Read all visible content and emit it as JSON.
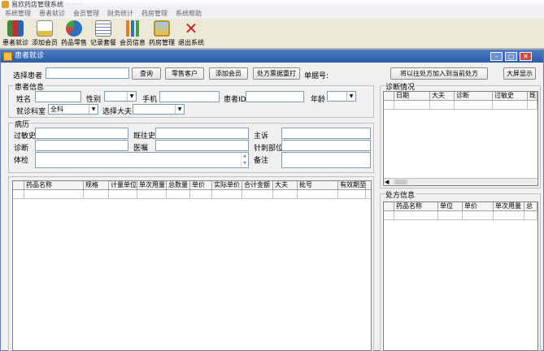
{
  "app": {
    "title": "易欣药店管理系统",
    "title_dim": "········"
  },
  "menu": [
    "系统管理",
    "患者就诊",
    "会员管理",
    "财务统计",
    "药房管理",
    "系统帮助"
  ],
  "toolbar": [
    {
      "label": "患者就诊",
      "icon": "books-icon",
      "color": "#3a8a3a"
    },
    {
      "label": "添加会员",
      "icon": "add-member-icon",
      "color": "#e0c040"
    },
    {
      "label": "药品零售",
      "icon": "pie-chart-icon",
      "color": "#3070c0"
    },
    {
      "label": "记录套餐",
      "icon": "list-icon",
      "color": "#f0f0f0"
    },
    {
      "label": "会员信息",
      "icon": "bar-chart-icon",
      "color": "#e08020"
    },
    {
      "label": "药房管理",
      "icon": "picture-icon",
      "color": "#f0c040"
    },
    {
      "label": "退出系统",
      "icon": "close-icon",
      "color": "#d02020"
    }
  ],
  "window": {
    "title": "患者就诊"
  },
  "top": {
    "select_patient_label": "选择患者",
    "select_patient_value": "",
    "query": "查询",
    "walkin": "零售客户",
    "add_member": "添加会员",
    "reprint": "处方票据重打",
    "order_no_label": "单据号:",
    "add_prev": "将以往处方加入到当前处方",
    "big_screen": "大屏显示"
  },
  "patient": {
    "group": "患者信息",
    "name": "姓名",
    "gender": "性别",
    "phone": "手机",
    "pid": "患者ID",
    "age": "年龄",
    "dept": "就诊科室",
    "dept_value": "全科",
    "doctor": "选择大夫"
  },
  "history": {
    "group": "病历",
    "allergy": "过敏史",
    "past": "既往史",
    "complaint": "主诉",
    "diagnosis": "诊断",
    "advice": "医嘱",
    "acupoint": "针刺部位",
    "exam": "体检",
    "remark": "备注"
  },
  "drug_grid": {
    "columns": [
      "药品名称",
      "规格",
      "计量单位",
      "单次用量",
      "总数量",
      "单价",
      "实际单价",
      "合计金额",
      "大夫",
      "批号",
      "有效期至"
    ]
  },
  "diag_panel": {
    "group": "诊断情况",
    "columns": [
      "日期",
      "大夫",
      "诊断",
      "过敏史",
      "既"
    ]
  },
  "rx_panel": {
    "group": "处方信息",
    "columns": [
      "药品名称",
      "单位",
      "单价",
      "单次用量",
      "总"
    ]
  }
}
